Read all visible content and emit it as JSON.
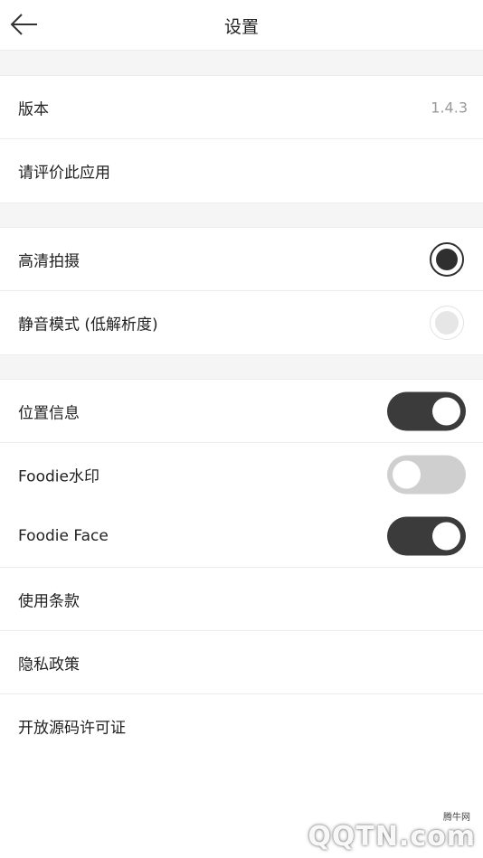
{
  "header": {
    "title": "设置"
  },
  "rows": {
    "version": {
      "label": "版本",
      "value": "1.4.3"
    },
    "rate": {
      "label": "请评价此应用"
    },
    "hd": {
      "label": "高清拍摄",
      "selected": true
    },
    "silent": {
      "label": "静音模式 (低解析度)",
      "selected": false
    },
    "location": {
      "label": "位置信息",
      "enabled": true
    },
    "watermark": {
      "label": "Foodie水印",
      "enabled": false
    },
    "face": {
      "label": "Foodie Face",
      "enabled": true
    },
    "terms": {
      "label": "使用条款"
    },
    "privacy": {
      "label": "隐私政策"
    },
    "license": {
      "label": "开放源码许可证"
    }
  },
  "colors": {
    "accent": "#3b3b3b",
    "off": "#cfcfcf",
    "divider": "#ececec",
    "section_gap": "#f5f5f5"
  },
  "site_watermark": {
    "text": "QQTN.com",
    "small": "腾牛网"
  }
}
